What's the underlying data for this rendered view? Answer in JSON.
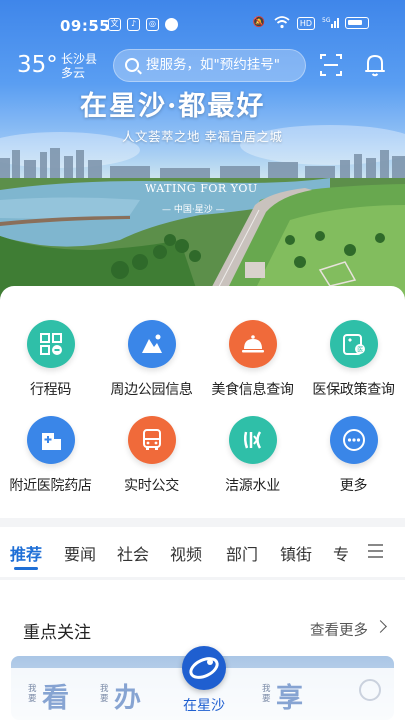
{
  "status_bar": {
    "time": "09:55",
    "network_badge": "HD",
    "signal_badge": "5G"
  },
  "weather": {
    "temperature": "35°",
    "location": "长沙县",
    "condition": "多云"
  },
  "search": {
    "placeholder": "搜服务，如\"预约挂号\""
  },
  "banner": {
    "slogan": "在星沙·都最好",
    "subtitle": "人文荟萃之地  幸福宜居之城",
    "watermark_en": "WATING FOR YOU",
    "watermark_cn": "— 中国·星沙 —"
  },
  "services": [
    {
      "label": "行程码",
      "icon": "qrcode-icon",
      "color": "#2fbfa8"
    },
    {
      "label": "周边公园信息",
      "icon": "mountain-icon",
      "color": "#3a86e8"
    },
    {
      "label": "美食信息查询",
      "icon": "food-cover-icon",
      "color": "#f06a3a"
    },
    {
      "label": "医保政策查询",
      "icon": "medical-card-icon",
      "color": "#2fbfa8"
    },
    {
      "label": "附近医院药店",
      "icon": "hospital-icon",
      "color": "#3a86e8"
    },
    {
      "label": "实时公交",
      "icon": "bus-icon",
      "color": "#f06a3a"
    },
    {
      "label": "洁源水业",
      "icon": "water-icon",
      "color": "#2fbfa8"
    },
    {
      "label": "更多",
      "icon": "more-icon",
      "color": "#3a86e8"
    }
  ],
  "tabs": [
    "推荐",
    "要闻",
    "社会",
    "视频",
    "部门",
    "镇街",
    "专"
  ],
  "focus": {
    "title": "重点关注",
    "more": "查看更多"
  },
  "bottom_nav": {
    "items": [
      {
        "small": "我要",
        "big": "看"
      },
      {
        "small": "我要",
        "big": "办"
      },
      {
        "small": "我要",
        "big": "享"
      }
    ],
    "center_label": "在星沙"
  }
}
